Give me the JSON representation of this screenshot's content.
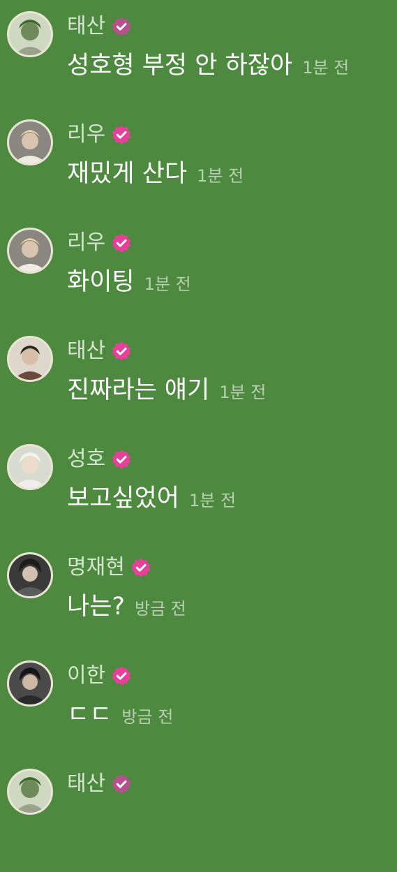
{
  "colors": {
    "background": "#4d8a3f",
    "badge": "#e8409a",
    "name_text": "#d6e5d0",
    "message_text": "#ffffff",
    "time_text": "#b9cfb2"
  },
  "messages": [
    {
      "user": "태산",
      "text": "성호형 부정 안 하잖아",
      "time": "1분 전",
      "badge_icon": "verified-badge-icon",
      "avatar": "avatar-taesan",
      "badge_color": "#b8508e"
    },
    {
      "user": "리우",
      "text": "재밌게 산다",
      "time": "1분 전",
      "badge_icon": "verified-badge-icon",
      "avatar": "avatar-riwoo",
      "badge_color": "#e8409a"
    },
    {
      "user": "리우",
      "text": "화이팅",
      "time": "1분 전",
      "badge_icon": "verified-badge-icon",
      "avatar": "avatar-riwoo",
      "badge_color": "#e8409a"
    },
    {
      "user": "태산",
      "text": "진짜라는 얘기",
      "time": "1분 전",
      "badge_icon": "verified-badge-icon",
      "avatar": "avatar-taesan-2",
      "badge_color": "#e8409a"
    },
    {
      "user": "성호",
      "text": "보고싶었어",
      "time": "1분 전",
      "badge_icon": "verified-badge-icon",
      "avatar": "avatar-sungho",
      "badge_color": "#e8409a"
    },
    {
      "user": "명재현",
      "text": "나는?",
      "time": "방금 전",
      "badge_icon": "verified-badge-icon",
      "avatar": "avatar-myungjaehyun",
      "badge_color": "#e8409a"
    },
    {
      "user": "이한",
      "text": "ㄷㄷ",
      "time": "방금 전",
      "badge_icon": "verified-badge-icon",
      "avatar": "avatar-leehan",
      "badge_color": "#e8409a"
    },
    {
      "user": "태산",
      "text": "",
      "time": "",
      "badge_icon": "verified-badge-icon",
      "avatar": "avatar-taesan",
      "badge_color": "#b8508e"
    }
  ]
}
